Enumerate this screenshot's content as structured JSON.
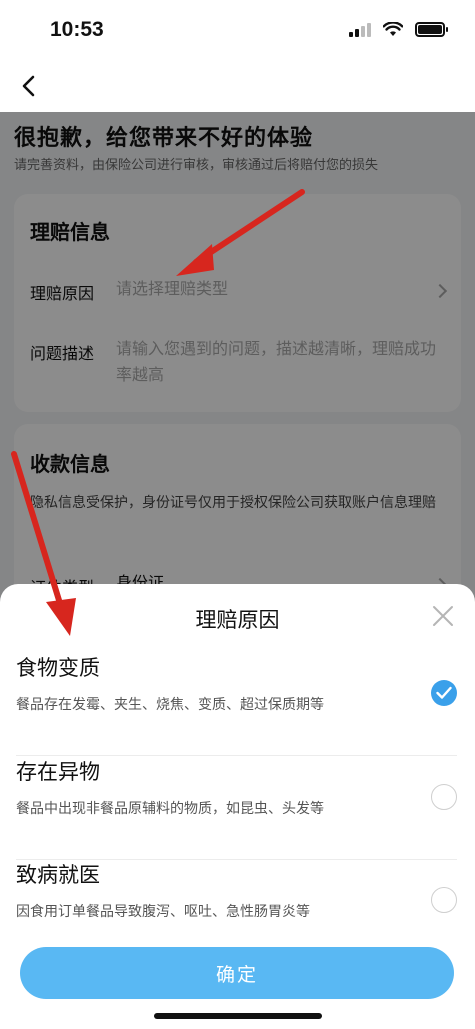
{
  "status_bar": {
    "time": "10:53"
  },
  "page": {
    "apology_title": "很抱歉，给您带来不好的体验",
    "apology_subtitle": "请完善资料，由保险公司进行审核，审核通过后将赔付您的损失",
    "claim_card": {
      "title": "理赔信息",
      "reason_label": "理赔原因",
      "reason_placeholder": "请选择理赔类型",
      "desc_label": "问题描述",
      "desc_placeholder": "请输入您遇到的问题，描述越清晰，理赔成功率越高"
    },
    "payment_card": {
      "title": "收款信息",
      "privacy_note": "隐私信息受保护，身份证号仅用于授权保险公司获取账户信息理赔",
      "id_type_label": "证件类型",
      "id_type_value": "身份证"
    }
  },
  "sheet": {
    "title": "理赔原因",
    "options": [
      {
        "title": "食物变质",
        "desc": "餐品存在发霉、夹生、烧焦、变质、超过保质期等",
        "selected": true
      },
      {
        "title": "存在异物",
        "desc": "餐品中出现非餐品原辅料的物质，如昆虫、头发等",
        "selected": false
      },
      {
        "title": "致病就医",
        "desc": "因食用订单餐品导致腹泻、呕吐、急性肠胃炎等",
        "selected": false
      }
    ],
    "confirm_label": "确定"
  },
  "icons": {
    "back": "back-arrow-icon",
    "close": "close-icon",
    "check": "checkmark-icon",
    "wifi": "wifi-icon",
    "signal": "signal-icon",
    "battery": "battery-icon"
  },
  "colors": {
    "accent": "#3aa0ea",
    "confirm_button": "#59b8f3",
    "annotation_arrow": "#d7261e"
  }
}
